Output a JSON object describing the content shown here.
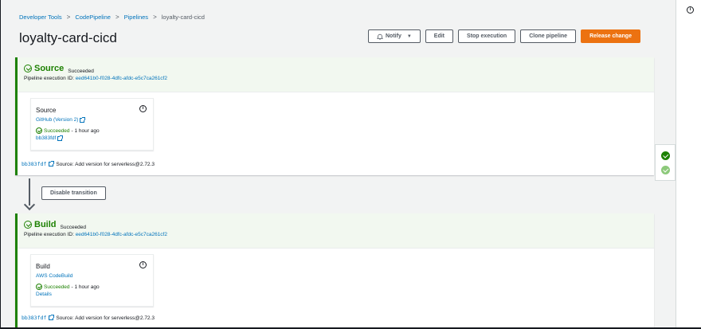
{
  "breadcrumb": {
    "items": [
      "Developer Tools",
      "CodePipeline",
      "Pipelines"
    ],
    "current": "loyalty-card-cicd",
    "separator": ">"
  },
  "page": {
    "title": "loyalty-card-cicd"
  },
  "actions": {
    "notify": "Notify",
    "edit": "Edit",
    "stop": "Stop execution",
    "clone": "Clone pipeline",
    "release": "Release change"
  },
  "stages": [
    {
      "name": "Source",
      "status": "Succeeded",
      "exec_label": "Pipeline execution ID:",
      "exec_id": "eed641b0-f028-4dfc-afdc-e5c7ca261cf2",
      "action": {
        "name": "Source",
        "provider": "GitHub (Version 2)",
        "status": "Succeeded",
        "time": "- 1 hour ago",
        "link": "bb383fdf"
      },
      "commit": {
        "id": "bb383fdf",
        "message": "Source: Add version for serverless@2.72.3"
      }
    },
    {
      "name": "Build",
      "status": "Succeeded",
      "exec_label": "Pipeline execution ID:",
      "exec_id": "eed641b0-f028-4dfc-afdc-e5c7ca261cf2",
      "action": {
        "name": "Build",
        "provider": "AWS CodeBuild",
        "status": "Succeeded",
        "time": "- 1 hour ago",
        "link": "Details"
      },
      "commit": {
        "id": "bb383fdf",
        "message": "Source: Add version for serverless@2.72.3"
      }
    }
  ],
  "transition": {
    "button": "Disable transition"
  },
  "colors": {
    "success": "#1d8102",
    "primary": "#ec7211",
    "link": "#0073bb",
    "stage_header_bg": "#f2f8f0"
  },
  "icons": {
    "info": "i",
    "dropdown": "▼",
    "bell": "bell-icon",
    "external": "external-link-icon",
    "check": "check-circle-icon"
  }
}
